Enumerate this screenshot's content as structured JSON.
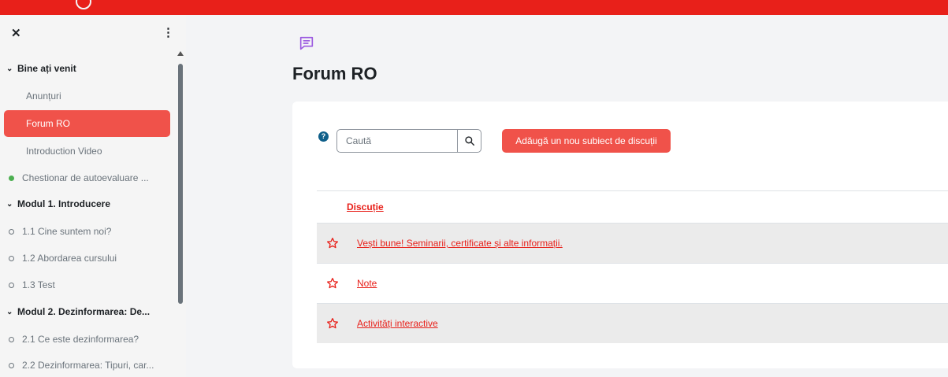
{
  "colors": {
    "brand": "#e8201a",
    "active_bg": "#f0524a",
    "complete_dot": "#4caf50",
    "help": "#0f5f8a"
  },
  "sidebar": {
    "close_icon": "close-icon",
    "menu_icon": "kebab-menu-icon",
    "items": [
      {
        "label": "Bine ați venit",
        "kind": "section"
      },
      {
        "label": "Anunțuri",
        "kind": "sub"
      },
      {
        "label": "Forum RO",
        "kind": "sub",
        "active": true
      },
      {
        "label": "Introduction Video",
        "kind": "sub"
      },
      {
        "label": "Chestionar de autoevaluare ...",
        "kind": "complete"
      },
      {
        "label": "Modul 1. Introducere",
        "kind": "section"
      },
      {
        "label": "1.1 Cine suntem noi?",
        "kind": "pending"
      },
      {
        "label": "1.2 Abordarea cursului",
        "kind": "pending"
      },
      {
        "label": "1.3 Test",
        "kind": "pending"
      },
      {
        "label": "Modul 2. Dezinformarea: De...",
        "kind": "section"
      },
      {
        "label": "2.1 Ce este dezinformarea?",
        "kind": "pending"
      },
      {
        "label": "2.2 Dezinformarea: Tipuri, car...",
        "kind": "pending"
      }
    ]
  },
  "main": {
    "page_icon": "forum-icon",
    "title": "Forum RO",
    "search": {
      "placeholder": "Caută"
    },
    "add_button": "Adăugă un nou subiect de discuții",
    "table": {
      "column_header": "Discuție",
      "rows": [
        {
          "title": "Vești bune! Seminarii, certificate și alte informații."
        },
        {
          "title": "Note"
        },
        {
          "title": "Activități interactive"
        }
      ]
    }
  }
}
